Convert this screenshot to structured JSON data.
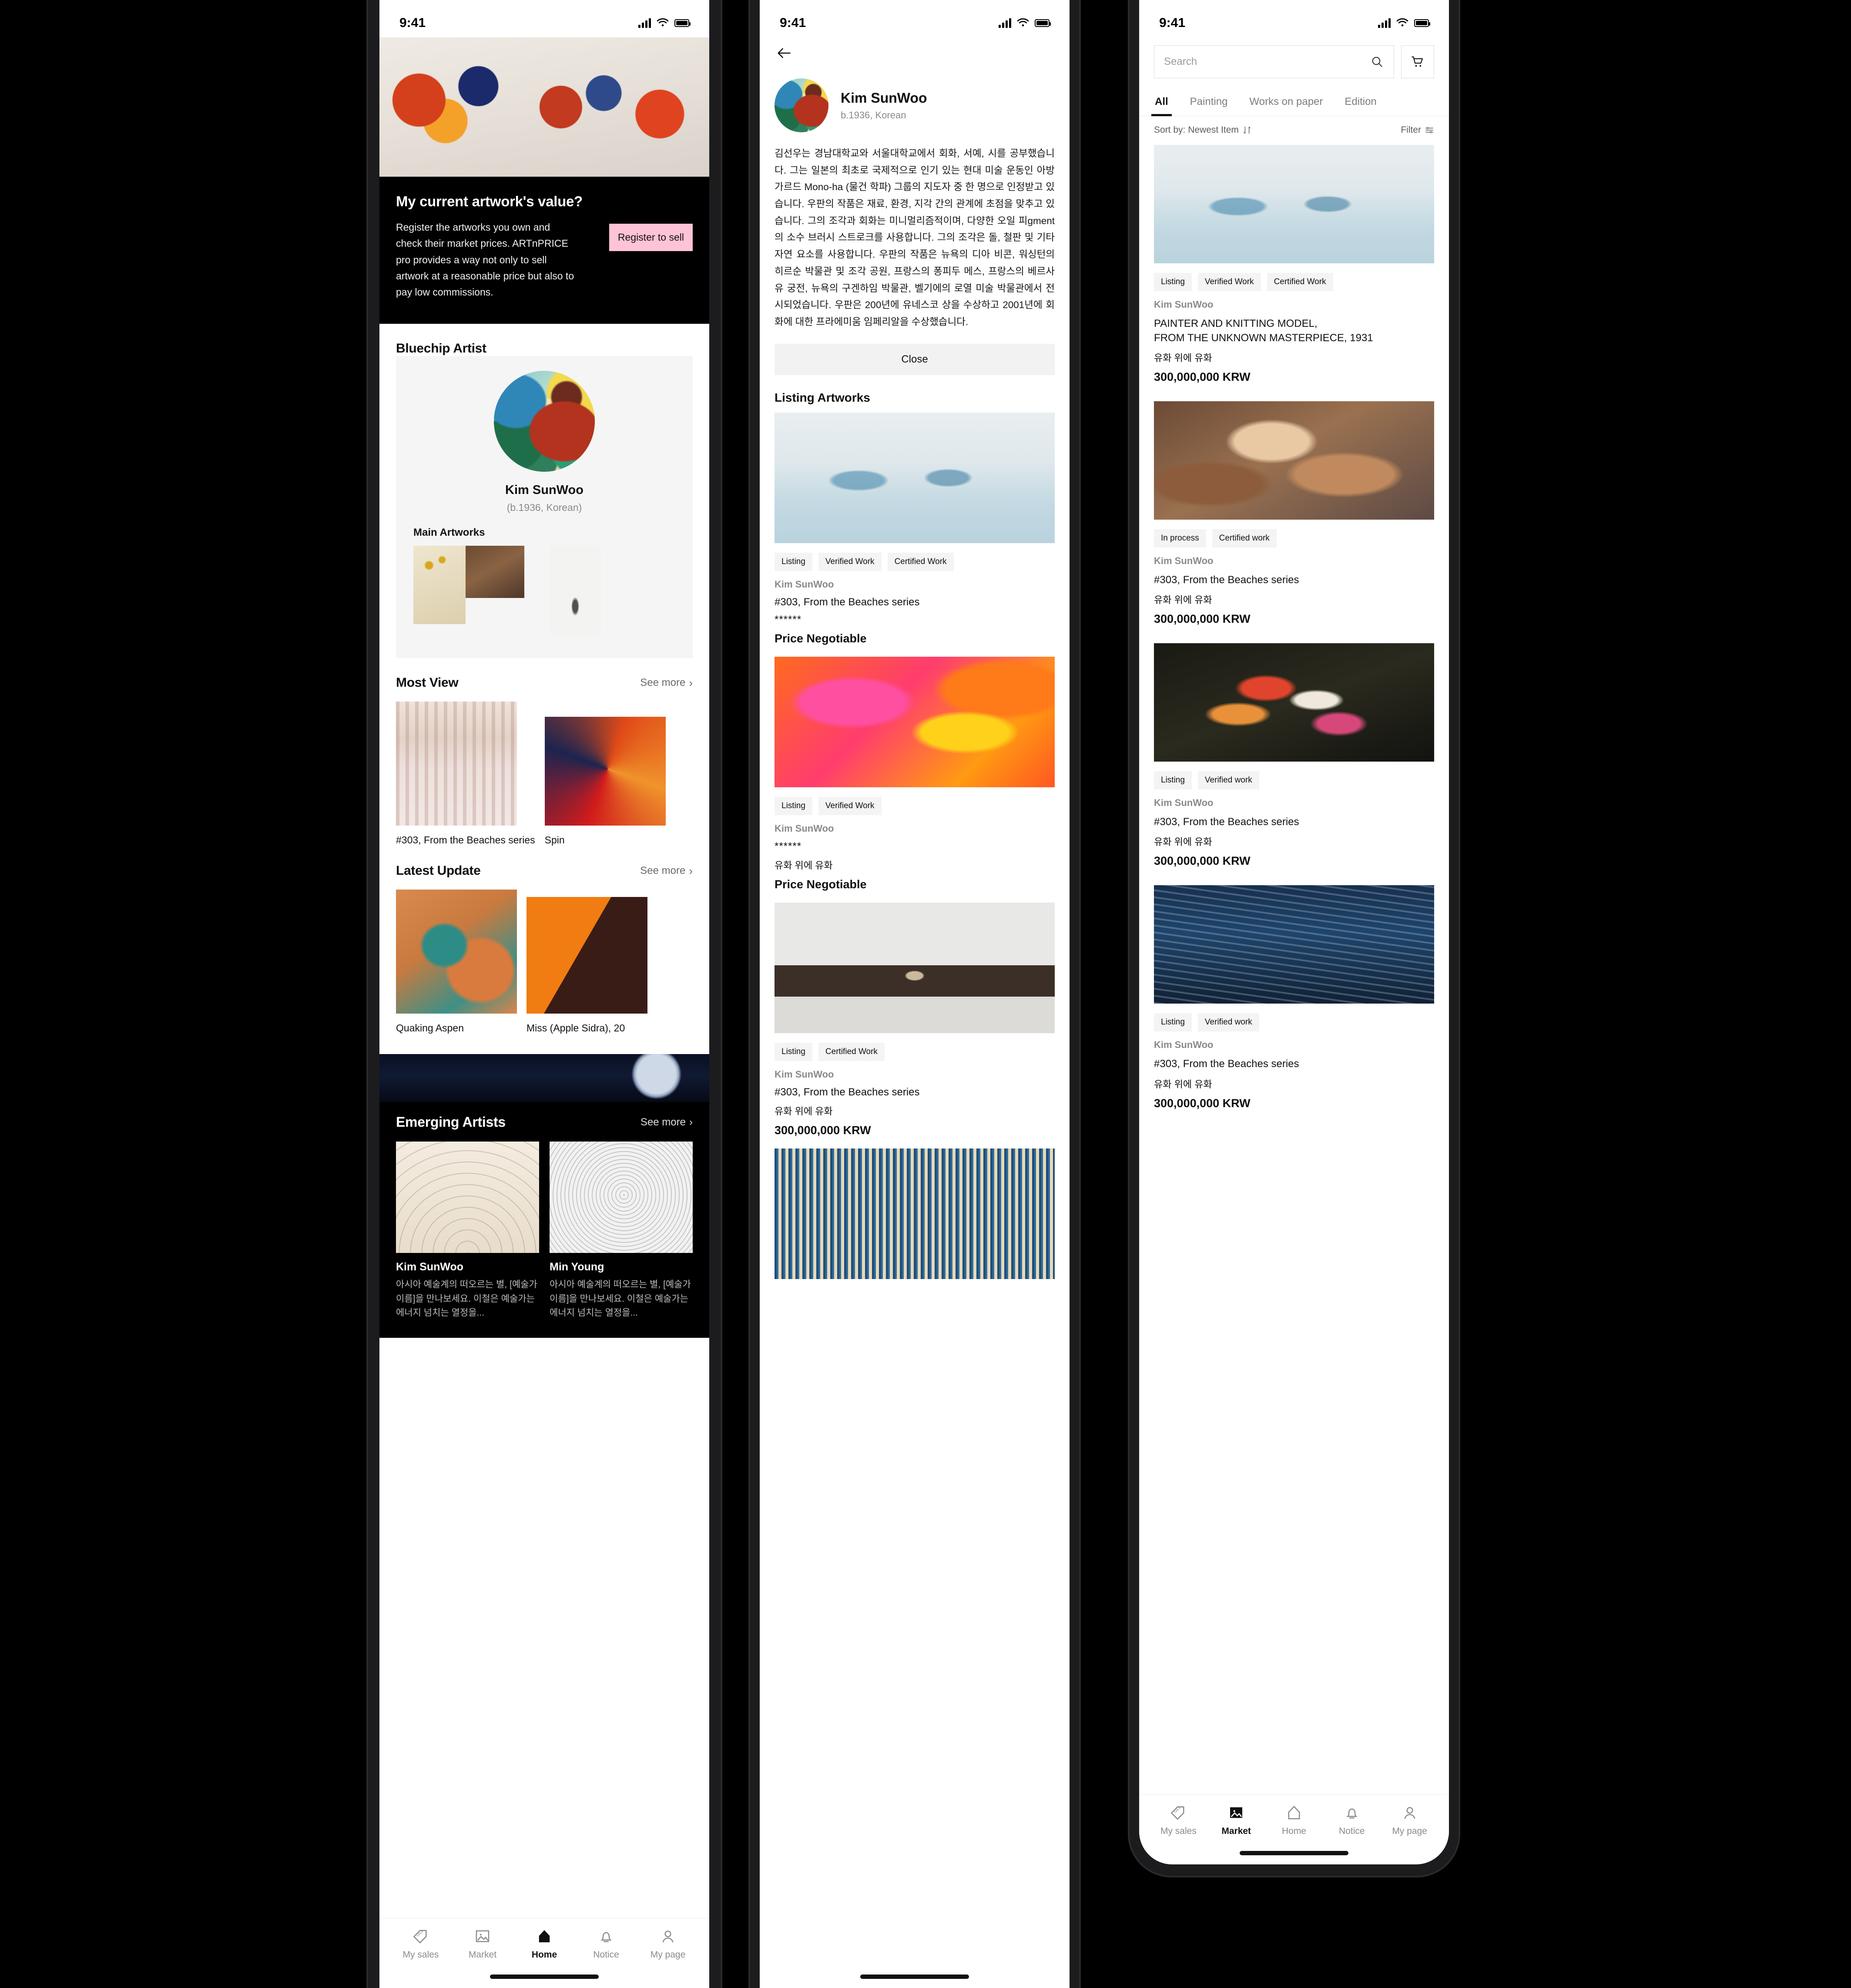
{
  "status_bar": {
    "time": "9:41"
  },
  "phone1": {
    "promo": {
      "headline": "My current artwork's value?",
      "body": "Register the artworks you own and check their market prices. ARTnPRICE pro provides a way not only to sell artwork at a reasonable price but also to pay low commissions.",
      "cta": "Register to sell"
    },
    "bluechip": {
      "section_title": "Bluechip Artist",
      "artist_name": "Kim SunWoo",
      "artist_sub": "(b.1936, Korean)",
      "main_artworks_label": "Main Artworks"
    },
    "most_view": {
      "title": "Most View",
      "see_more": "See more",
      "items": [
        {
          "caption": "#303, From the Beaches series"
        },
        {
          "caption": "Spin"
        }
      ]
    },
    "latest_update": {
      "title": "Latest Update",
      "see_more": "See more",
      "items": [
        {
          "caption": "Quaking Aspen"
        },
        {
          "caption": "Miss (Apple Sidra), 20"
        }
      ]
    },
    "emerging": {
      "title": "Emerging Artists",
      "see_more": "See more",
      "items": [
        {
          "name": "Kim SunWoo",
          "desc": "아시아 예술계의 떠오르는 별, [예술가 이름]을 만나보세요. 이철은 예술가는 에너지 넘치는 열정을..."
        },
        {
          "name": "Min Young",
          "desc": "아시아 예술계의 떠오르는 별, [예술가 이름]을 만나보세요. 이철은 예술가는 에너지 넘치는 열정을..."
        }
      ]
    },
    "tabbar": {
      "active": "Home",
      "items": [
        {
          "label": "My sales",
          "icon": "sale-tag-icon"
        },
        {
          "label": "Market",
          "icon": "image-icon"
        },
        {
          "label": "Home",
          "icon": "home-icon"
        },
        {
          "label": "Notice",
          "icon": "bell-icon"
        },
        {
          "label": "My page",
          "icon": "person-icon"
        }
      ]
    }
  },
  "phone2": {
    "back_icon": "back-arrow-icon",
    "artist": {
      "name": "Kim SunWoo",
      "sub": "b.1936, Korean",
      "bio": "김선우는 경남대학교와 서울대학교에서 회화, 서예, 시를 공부했습니다. 그는 일본의 최초로 국제적으로 인기 있는 현대 미술 운동인 아방가르드 Mono-ha (물건 학파) 그룹의 지도자 중 한 명으로 인정받고 있습니다. 우판의 작품은 재료, 환경, 지각 간의 관계에 초점을 맞추고 있습니다. 그의 조각과 회화는 미니멀리즘적이며, 다양한 오일 피gment의 소수 브러시 스트로크를 사용합니다. 그의 조각은 돌, 철판 및 기타 자연 요소를 사용합니다. 우판의 작품은 뉴욕의 디아 비콘, 워싱턴의 히르순 박물관 및 조각 공원, 프랑스의 퐁피두 메스, 프랑스의 베르사유 궁전, 뉴욕의 구겐하임 박물관, 벨기에의 로열 미술 박물관에서 전시되었습니다. 우판은 200년에 유네스코 상을 수상하고 2001년에 회화에 대한 프라에미움 임페리알을 수상했습니다.",
      "close_label": "Close"
    },
    "listing_title": "Listing Artworks",
    "listings": [
      {
        "badges": [
          "Listing",
          "Verified Work",
          "Certified Work"
        ],
        "artist": "Kim SunWoo",
        "title": "#303, From the Beaches series",
        "stars": "******",
        "medium": "",
        "price": "Price Negotiable",
        "art": "g-boats"
      },
      {
        "badges": [
          "Listing",
          "Verified Work"
        ],
        "artist": "Kim SunWoo",
        "title": "",
        "stars": "******",
        "medium": "유화 위에 유화",
        "price": "Price Negotiable",
        "art": "g-abstract-orange"
      },
      {
        "badges": [
          "Listing",
          "Certified Work"
        ],
        "artist": "Kim SunWoo",
        "title": "#303, From the Beaches series",
        "stars": "",
        "medium": "유화 위에 유화",
        "price": "300,000,000 KRW",
        "art": "g-stone"
      },
      {
        "badges": [],
        "artist": "",
        "title": "",
        "stars": "",
        "medium": "",
        "price": "",
        "art": "g-sticks"
      }
    ]
  },
  "phone3": {
    "search": {
      "placeholder": "Search",
      "value": "",
      "icon": "search-icon"
    },
    "cart_icon": "cart-icon",
    "tabs": [
      {
        "label": "All",
        "active": true
      },
      {
        "label": "Painting",
        "active": false
      },
      {
        "label": "Works on paper",
        "active": false
      },
      {
        "label": "Edition",
        "active": false
      }
    ],
    "sort_label": "Sort by: Newest Item",
    "sort_icon": "sort-arrows-icon",
    "filter_label": "Filter",
    "filter_icon": "filter-icon",
    "cards": [
      {
        "badges": [
          "Listing",
          "Verified Work",
          "Certified Work"
        ],
        "artist": "Kim SunWoo",
        "title": "PAINTER AND KNITTING MODEL,\nFROM THE UNKNOWN MASTERPIECE, 1931",
        "medium": "유화 위에 유화",
        "price": "300,000,000 KRW",
        "art": "g-boats"
      },
      {
        "badges": [
          "In process",
          "Certified work"
        ],
        "artist": "Kim SunWoo",
        "title": "#303, From the Beaches series",
        "medium": "유화 위에 유화",
        "price": "300,000,000 KRW",
        "art": "g-baroque"
      },
      {
        "badges": [
          "Listing",
          "Verified work"
        ],
        "artist": "Kim SunWoo",
        "title": "#303, From the Beaches series",
        "medium": "유화 위에 유화",
        "price": "300,000,000 KRW",
        "art": "g-flowers"
      },
      {
        "badges": [
          "Listing",
          "Verified work"
        ],
        "artist": "Kim SunWoo",
        "title": "#303, From the Beaches series",
        "medium": "유화 위에 유화",
        "price": "300,000,000 KRW",
        "art": "g-wave"
      }
    ],
    "tabbar": {
      "active": "Market",
      "items": [
        {
          "label": "My sales",
          "icon": "sale-tag-icon"
        },
        {
          "label": "Market",
          "icon": "image-icon"
        },
        {
          "label": "Home",
          "icon": "home-icon"
        },
        {
          "label": "Notice",
          "icon": "bell-icon"
        },
        {
          "label": "My page",
          "icon": "person-icon"
        }
      ]
    }
  },
  "colors": {
    "accent_pink": "#ffc3d6",
    "ink": "#111111",
    "muted": "#8a8a8a",
    "chip_bg": "#f4f4f4"
  }
}
